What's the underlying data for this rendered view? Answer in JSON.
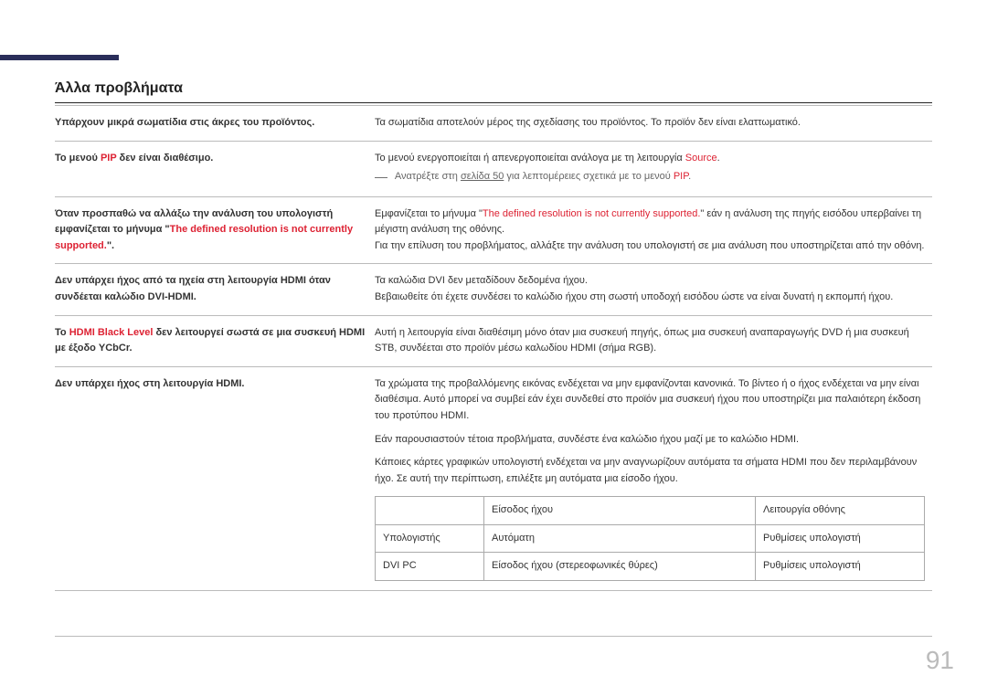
{
  "title": "Άλλα προβλήματα",
  "rows": [
    {
      "left": [
        {
          "t": "Υπάρχουν μικρά σωματίδια στις άκρες του προϊόντος."
        }
      ],
      "right": [
        {
          "t": "Τα σωματίδια αποτελούν μέρος της σχεδίασης του προϊόντος. Το προϊόν δεν είναι ελαττωματικό."
        }
      ]
    },
    {
      "left": [
        {
          "t": "Το μενού "
        },
        {
          "t": "PIP",
          "red": true
        },
        {
          "t": " δεν είναι διαθέσιμο."
        }
      ],
      "right": [
        {
          "t": "Το μενού ενεργοποιείται ή απενεργοποιείται ανάλογα με τη λειτουργία "
        },
        {
          "t": "Source",
          "red": true
        },
        {
          "t": "."
        },
        {
          "br": true
        },
        {
          "t": "― ",
          "grey": true,
          "dash": true
        },
        {
          "t": "Ανατρέξτε στη ",
          "grey": true
        },
        {
          "t": "σελίδα 50",
          "link": true,
          "grey": true
        },
        {
          "t": " για λεπτομέρειες σχετικά με το μενού ",
          "grey": true
        },
        {
          "t": "PIP",
          "red": true
        },
        {
          "t": ".",
          "grey": true
        }
      ]
    },
    {
      "left": [
        {
          "t": "Όταν προσπαθώ να αλλάξω την ανάλυση του υπολογιστή εμφανίζεται το μήνυμα \""
        },
        {
          "t": "The defined resolution is not currently supported.",
          "red": true
        },
        {
          "t": "\"."
        }
      ],
      "right": [
        {
          "t": "Εμφανίζεται το μήνυμα \""
        },
        {
          "t": "The defined resolution is not currently supported.",
          "red": true
        },
        {
          "t": "\" εάν η ανάλυση της πηγής εισόδου υπερβαίνει τη μέγιστη ανάλυση της οθόνης."
        },
        {
          "br": true
        },
        {
          "t": "Για την επίλυση του προβλήματος, αλλάξτε την ανάλυση του υπολογιστή σε μια ανάλυση που υποστηρίζεται από την οθόνη."
        }
      ]
    },
    {
      "left": [
        {
          "t": "Δεν υπάρχει ήχος από τα ηχεία στη λειτουργία HDMI όταν συνδέεται καλώδιο DVI-HDMI."
        }
      ],
      "right": [
        {
          "t": "Τα καλώδια DVI δεν μεταδίδουν δεδομένα ήχου."
        },
        {
          "br": true
        },
        {
          "t": "Βεβαιωθείτε ότι έχετε συνδέσει το καλώδιο ήχου στη σωστή υποδοχή εισόδου ώστε να είναι δυνατή η εκπομπή ήχου."
        }
      ]
    },
    {
      "left": [
        {
          "t": "Το "
        },
        {
          "t": "HDMI Black Level",
          "red": true
        },
        {
          "t": " δεν λειτουργεί σωστά σε μια συσκευή HDMI με έξοδο YCbCr."
        }
      ],
      "right": [
        {
          "t": "Αυτή η λειτουργία είναι διαθέσιμη μόνο όταν μια συσκευή πηγής, όπως μια συσκευή αναπαραγωγής DVD ή μια συσκευή STB, συνδέεται στο προϊόν μέσω καλωδίου HDMI (σήμα RGB)."
        }
      ]
    },
    {
      "left": [
        {
          "t": "Δεν υπάρχει ήχος στη λειτουργία HDMI."
        }
      ],
      "right": [
        {
          "t": "Τα χρώματα της προβαλλόμενης εικόνας ενδέχεται να μην εμφανίζονται κανονικά. Το βίντεο ή ο ήχος ενδέχεται να μην είναι διαθέσιμα. Αυτό μπορεί να συμβεί εάν έχει συνδεθεί στο προϊόν μια συσκευή ήχου που υποστηρίζει μια παλαιότερη έκδοση του προτύπου HDMI."
        },
        {
          "br": true
        },
        {
          "spacer": true
        },
        {
          "t": "Εάν παρουσιαστούν τέτοια προβλήματα, συνδέστε ένα καλώδιο ήχου μαζί με το καλώδιο HDMI."
        },
        {
          "br": true
        },
        {
          "spacer": true
        },
        {
          "t": "Κάποιες κάρτες γραφικών υπολογιστή ενδέχεται να μην αναγνωρίζουν αυτόματα τα σήματα HDMI που δεν περιλαμβάνουν ήχο. Σε αυτή την περίπτωση, επιλέξτε μη αυτόματα μια είσοδο ήχου."
        }
      ],
      "table": {
        "header": [
          "",
          "Είσοδος ήχου",
          "Λειτουργία οθόνης"
        ],
        "rows": [
          [
            "Υπολογιστής",
            "Αυτόματη",
            "Ρυθμίσεις υπολογιστή"
          ],
          [
            "DVI PC",
            "Είσοδος ήχου (στερεοφωνικές θύρες)",
            "Ρυθμίσεις υπολογιστή"
          ]
        ]
      }
    }
  ],
  "pagenum": "91"
}
